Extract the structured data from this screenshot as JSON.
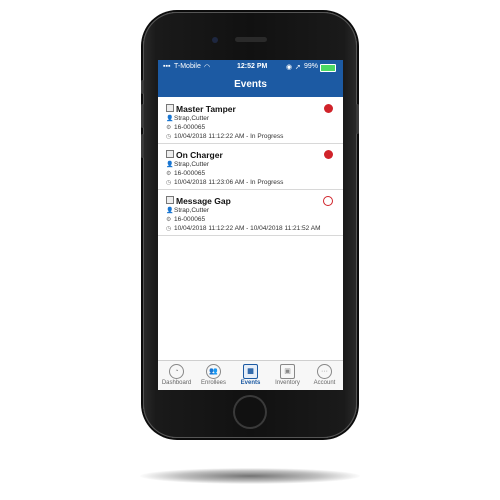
{
  "status_bar": {
    "carrier": "T-Mobile",
    "time": "12:52 PM",
    "battery": "99%"
  },
  "header": {
    "title": "Events"
  },
  "events": [
    {
      "title": "Master Tamper",
      "type": "Strap,Cutter",
      "device": "16-000065",
      "time": "10/04/2018 11:12:22 AM - In Progress",
      "indicator": "filled"
    },
    {
      "title": "On Charger",
      "type": "Strap,Cutter",
      "device": "16-000065",
      "time": "10/04/2018 11:23:06 AM - In Progress",
      "indicator": "filled"
    },
    {
      "title": "Message Gap",
      "type": "Strap,Cutter",
      "device": "16-000065",
      "time": "10/04/2018 11:12:22 AM - 10/04/2018 11:21:52 AM",
      "indicator": "hollow"
    }
  ],
  "tabs": [
    {
      "label": "Dashboard",
      "icon": "gauge-icon"
    },
    {
      "label": "Enrollees",
      "icon": "people-icon"
    },
    {
      "label": "Events",
      "icon": "calendar-icon"
    },
    {
      "label": "Inventory",
      "icon": "box-icon"
    },
    {
      "label": "Account",
      "icon": "more-icon"
    }
  ],
  "active_tab": "Events",
  "colors": {
    "header": "#1c5aa3",
    "indicator": "#d0232a"
  }
}
